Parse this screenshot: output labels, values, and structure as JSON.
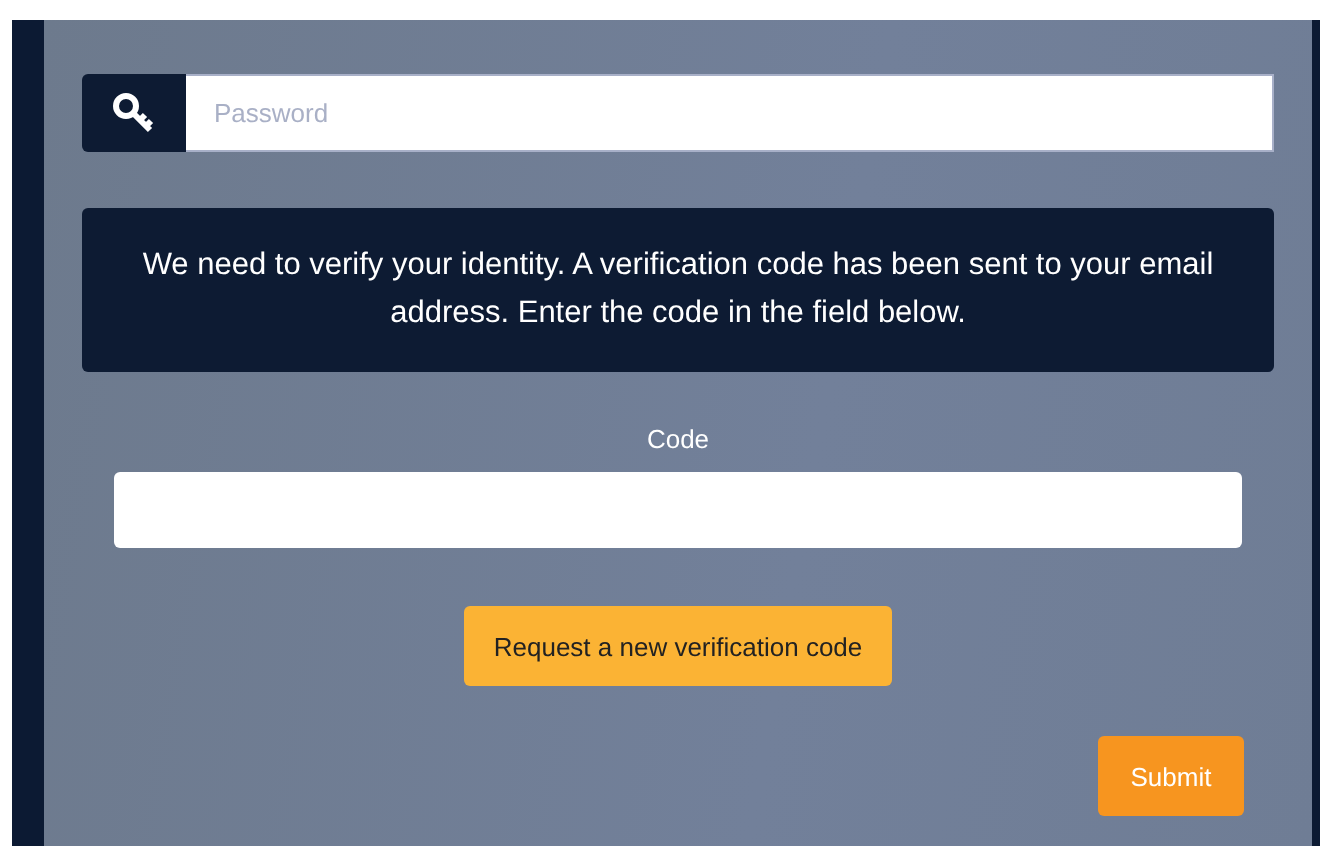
{
  "password_field": {
    "placeholder": "Password"
  },
  "message": "We need to verify your identity. A verification code has been sent to your email address. Enter the code in the field below.",
  "code_field": {
    "label": "Code"
  },
  "buttons": [
    {
      "kind": "secondary",
      "label": "Request a new verification code"
    },
    {
      "kind": "primary",
      "label": "Submit"
    }
  ]
}
